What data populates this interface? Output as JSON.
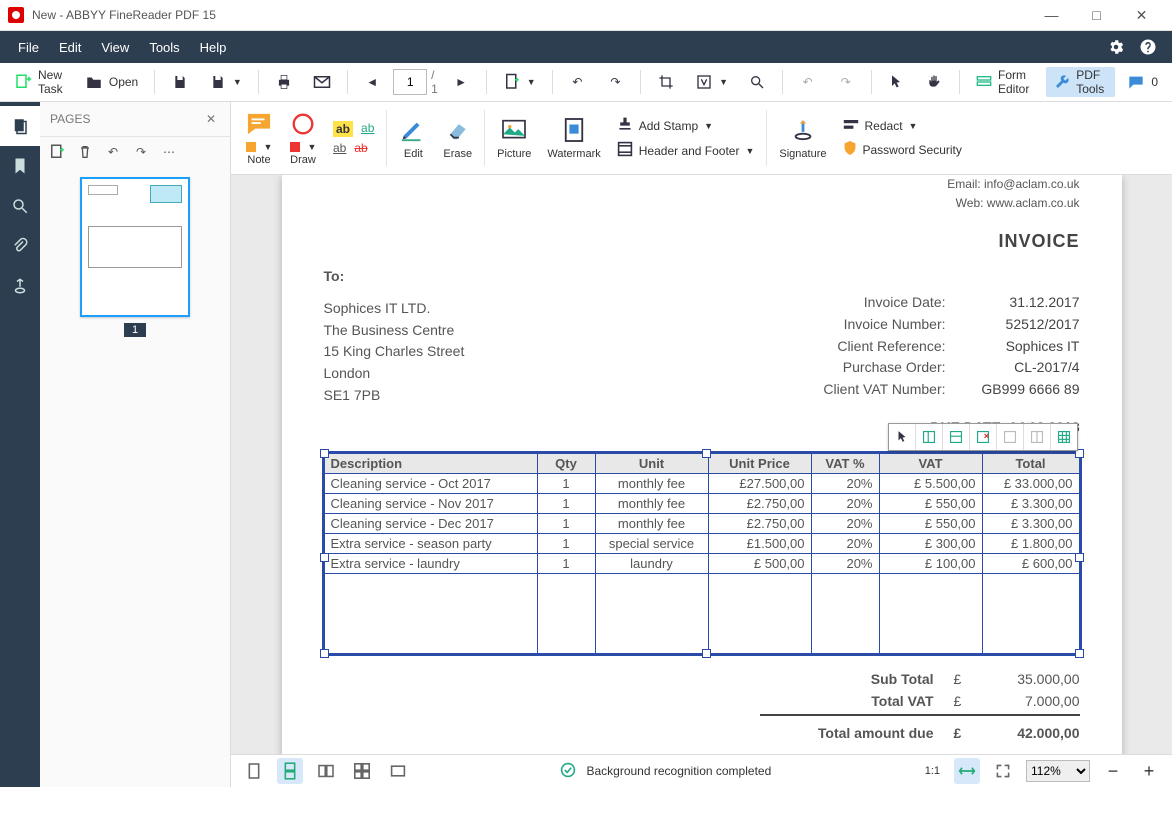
{
  "titlebar": {
    "title": "New - ABBYY FineReader PDF 15"
  },
  "window": {
    "min": "—",
    "max": "□",
    "close": "✕"
  },
  "menu": {
    "items": [
      "File",
      "Edit",
      "View",
      "Tools",
      "Help"
    ]
  },
  "toolbar1": {
    "newTask": "New Task",
    "open": "Open",
    "pageCurrent": "1",
    "pageTotal": "/ 1",
    "formEditor": "Form Editor",
    "pdfTools": "PDF Tools",
    "comments": "0"
  },
  "ribbon": {
    "note": "Note",
    "draw": "Draw",
    "edit": "Edit",
    "erase": "Erase",
    "picture": "Picture",
    "watermark": "Watermark",
    "addStamp": "Add Stamp",
    "headerFooter": "Header and Footer",
    "signature": "Signature",
    "redact": "Redact",
    "password": "Password Security"
  },
  "pagesPanel": {
    "title": "PAGES",
    "thumbNum": "1"
  },
  "doc": {
    "email": "Email: info@aclam.co.uk",
    "web": "Web: www.aclam.co.uk",
    "invoiceHeading": "INVOICE",
    "toLabel": "To:",
    "to": [
      "Sophices IT LTD.",
      "The Business Centre",
      "15 King Charles Street",
      "London",
      "SE1 7PB"
    ],
    "meta": [
      {
        "k": "Invoice Date:",
        "v": "31.12.2017"
      },
      {
        "k": "Invoice Number:",
        "v": "52512/2017"
      },
      {
        "k": "Client Reference:",
        "v": "Sophices IT"
      },
      {
        "k": "Purchase Order:",
        "v": "CL-2017/4"
      },
      {
        "k": "Client VAT Number:",
        "v": "GB999 6666 89"
      }
    ],
    "dueLabel": "DUE DATE:",
    "dueDate": "04.02.2018",
    "table": {
      "headers": [
        "Description",
        "Qty",
        "Unit",
        "Unit Price",
        "VAT %",
        "VAT",
        "Total"
      ],
      "rows": [
        [
          "Cleaning service - Oct 2017",
          "1",
          "monthly fee",
          "£27.500,00",
          "20%",
          "£  5.500,00",
          "£    33.000,00"
        ],
        [
          "Cleaning service - Nov 2017",
          "1",
          "monthly fee",
          "£2.750,00",
          "20%",
          "£     550,00",
          "£      3.300,00"
        ],
        [
          "Cleaning service - Dec 2017",
          "1",
          "monthly fee",
          "£2.750,00",
          "20%",
          "£     550,00",
          "£      3.300,00"
        ],
        [
          "Extra service - season party",
          "1",
          "special service",
          "£1.500,00",
          "20%",
          "£     300,00",
          "£      1.800,00"
        ],
        [
          "Extra service - laundry",
          "1",
          "laundry",
          "£     500,00",
          "20%",
          "£     100,00",
          "£         600,00"
        ]
      ]
    },
    "subTotalLabel": "Sub Total",
    "subTotalCur": "£",
    "subTotal": "35.000,00",
    "totalVatLabel": "Total VAT",
    "totalVatCur": "£",
    "totalVat": "7.000,00",
    "amountDueLabel": "Total amount due",
    "amountDueCur": "£",
    "amountDue": "42.000,00"
  },
  "status": {
    "msg": "Background recognition completed",
    "zoom": "112%",
    "fitLabel": "1:1"
  },
  "chart_data": {
    "type": "table",
    "title": "INVOICE",
    "columns": [
      "Description",
      "Qty",
      "Unit",
      "Unit Price",
      "VAT %",
      "VAT",
      "Total"
    ],
    "rows": [
      {
        "Description": "Cleaning service - Oct 2017",
        "Qty": 1,
        "Unit": "monthly fee",
        "Unit Price": 27500.0,
        "VAT %": 20,
        "VAT": 5500.0,
        "Total": 33000.0
      },
      {
        "Description": "Cleaning service - Nov 2017",
        "Qty": 1,
        "Unit": "monthly fee",
        "Unit Price": 2750.0,
        "VAT %": 20,
        "VAT": 550.0,
        "Total": 3300.0
      },
      {
        "Description": "Cleaning service - Dec 2017",
        "Qty": 1,
        "Unit": "monthly fee",
        "Unit Price": 2750.0,
        "VAT %": 20,
        "VAT": 550.0,
        "Total": 3300.0
      },
      {
        "Description": "Extra service - season party",
        "Qty": 1,
        "Unit": "special service",
        "Unit Price": 1500.0,
        "VAT %": 20,
        "VAT": 300.0,
        "Total": 1800.0
      },
      {
        "Description": "Extra service - laundry",
        "Qty": 1,
        "Unit": "laundry",
        "Unit Price": 500.0,
        "VAT %": 20,
        "VAT": 100.0,
        "Total": 600.0
      }
    ],
    "totals": {
      "Sub Total": 35000.0,
      "Total VAT": 7000.0,
      "Total amount due": 42000.0
    },
    "currency": "GBP"
  }
}
